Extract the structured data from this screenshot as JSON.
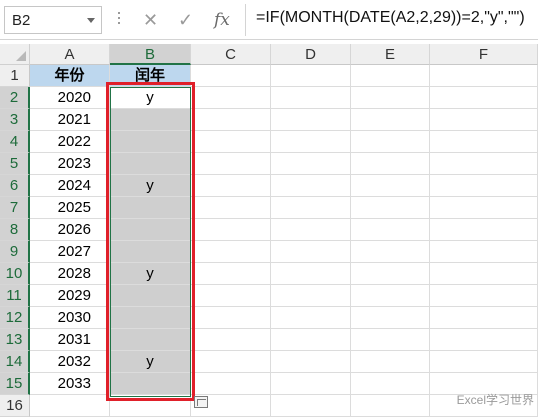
{
  "name_box": {
    "value": "B2"
  },
  "formula_bar": {
    "cancel_icon": "✕",
    "enter_icon": "✓",
    "function_icon": "fx",
    "formula": "=IF(MONTH(DATE(A2,2,29))=2,\"y\",\"\")"
  },
  "columns": [
    "A",
    "B",
    "C",
    "D",
    "E",
    "F"
  ],
  "rows": [
    "1",
    "2",
    "3",
    "4",
    "5",
    "6",
    "7",
    "8",
    "9",
    "10",
    "11",
    "12",
    "13",
    "14",
    "15",
    "16"
  ],
  "table": {
    "header_a": "年份",
    "header_b": "闰年",
    "years": [
      "2020",
      "2021",
      "2022",
      "2023",
      "2024",
      "2025",
      "2026",
      "2027",
      "2028",
      "2029",
      "2030",
      "2031",
      "2032",
      "2033"
    ],
    "leap": [
      "y",
      "",
      "",
      "",
      "y",
      "",
      "",
      "",
      "y",
      "",
      "",
      "",
      "y",
      ""
    ]
  },
  "colors": {
    "header_fill": "#bdd7ee",
    "selection_fill": "#cfcfcf",
    "selection_border": "#217346",
    "annotation_red": "#e0202a"
  },
  "watermark": "Excel学习世界"
}
